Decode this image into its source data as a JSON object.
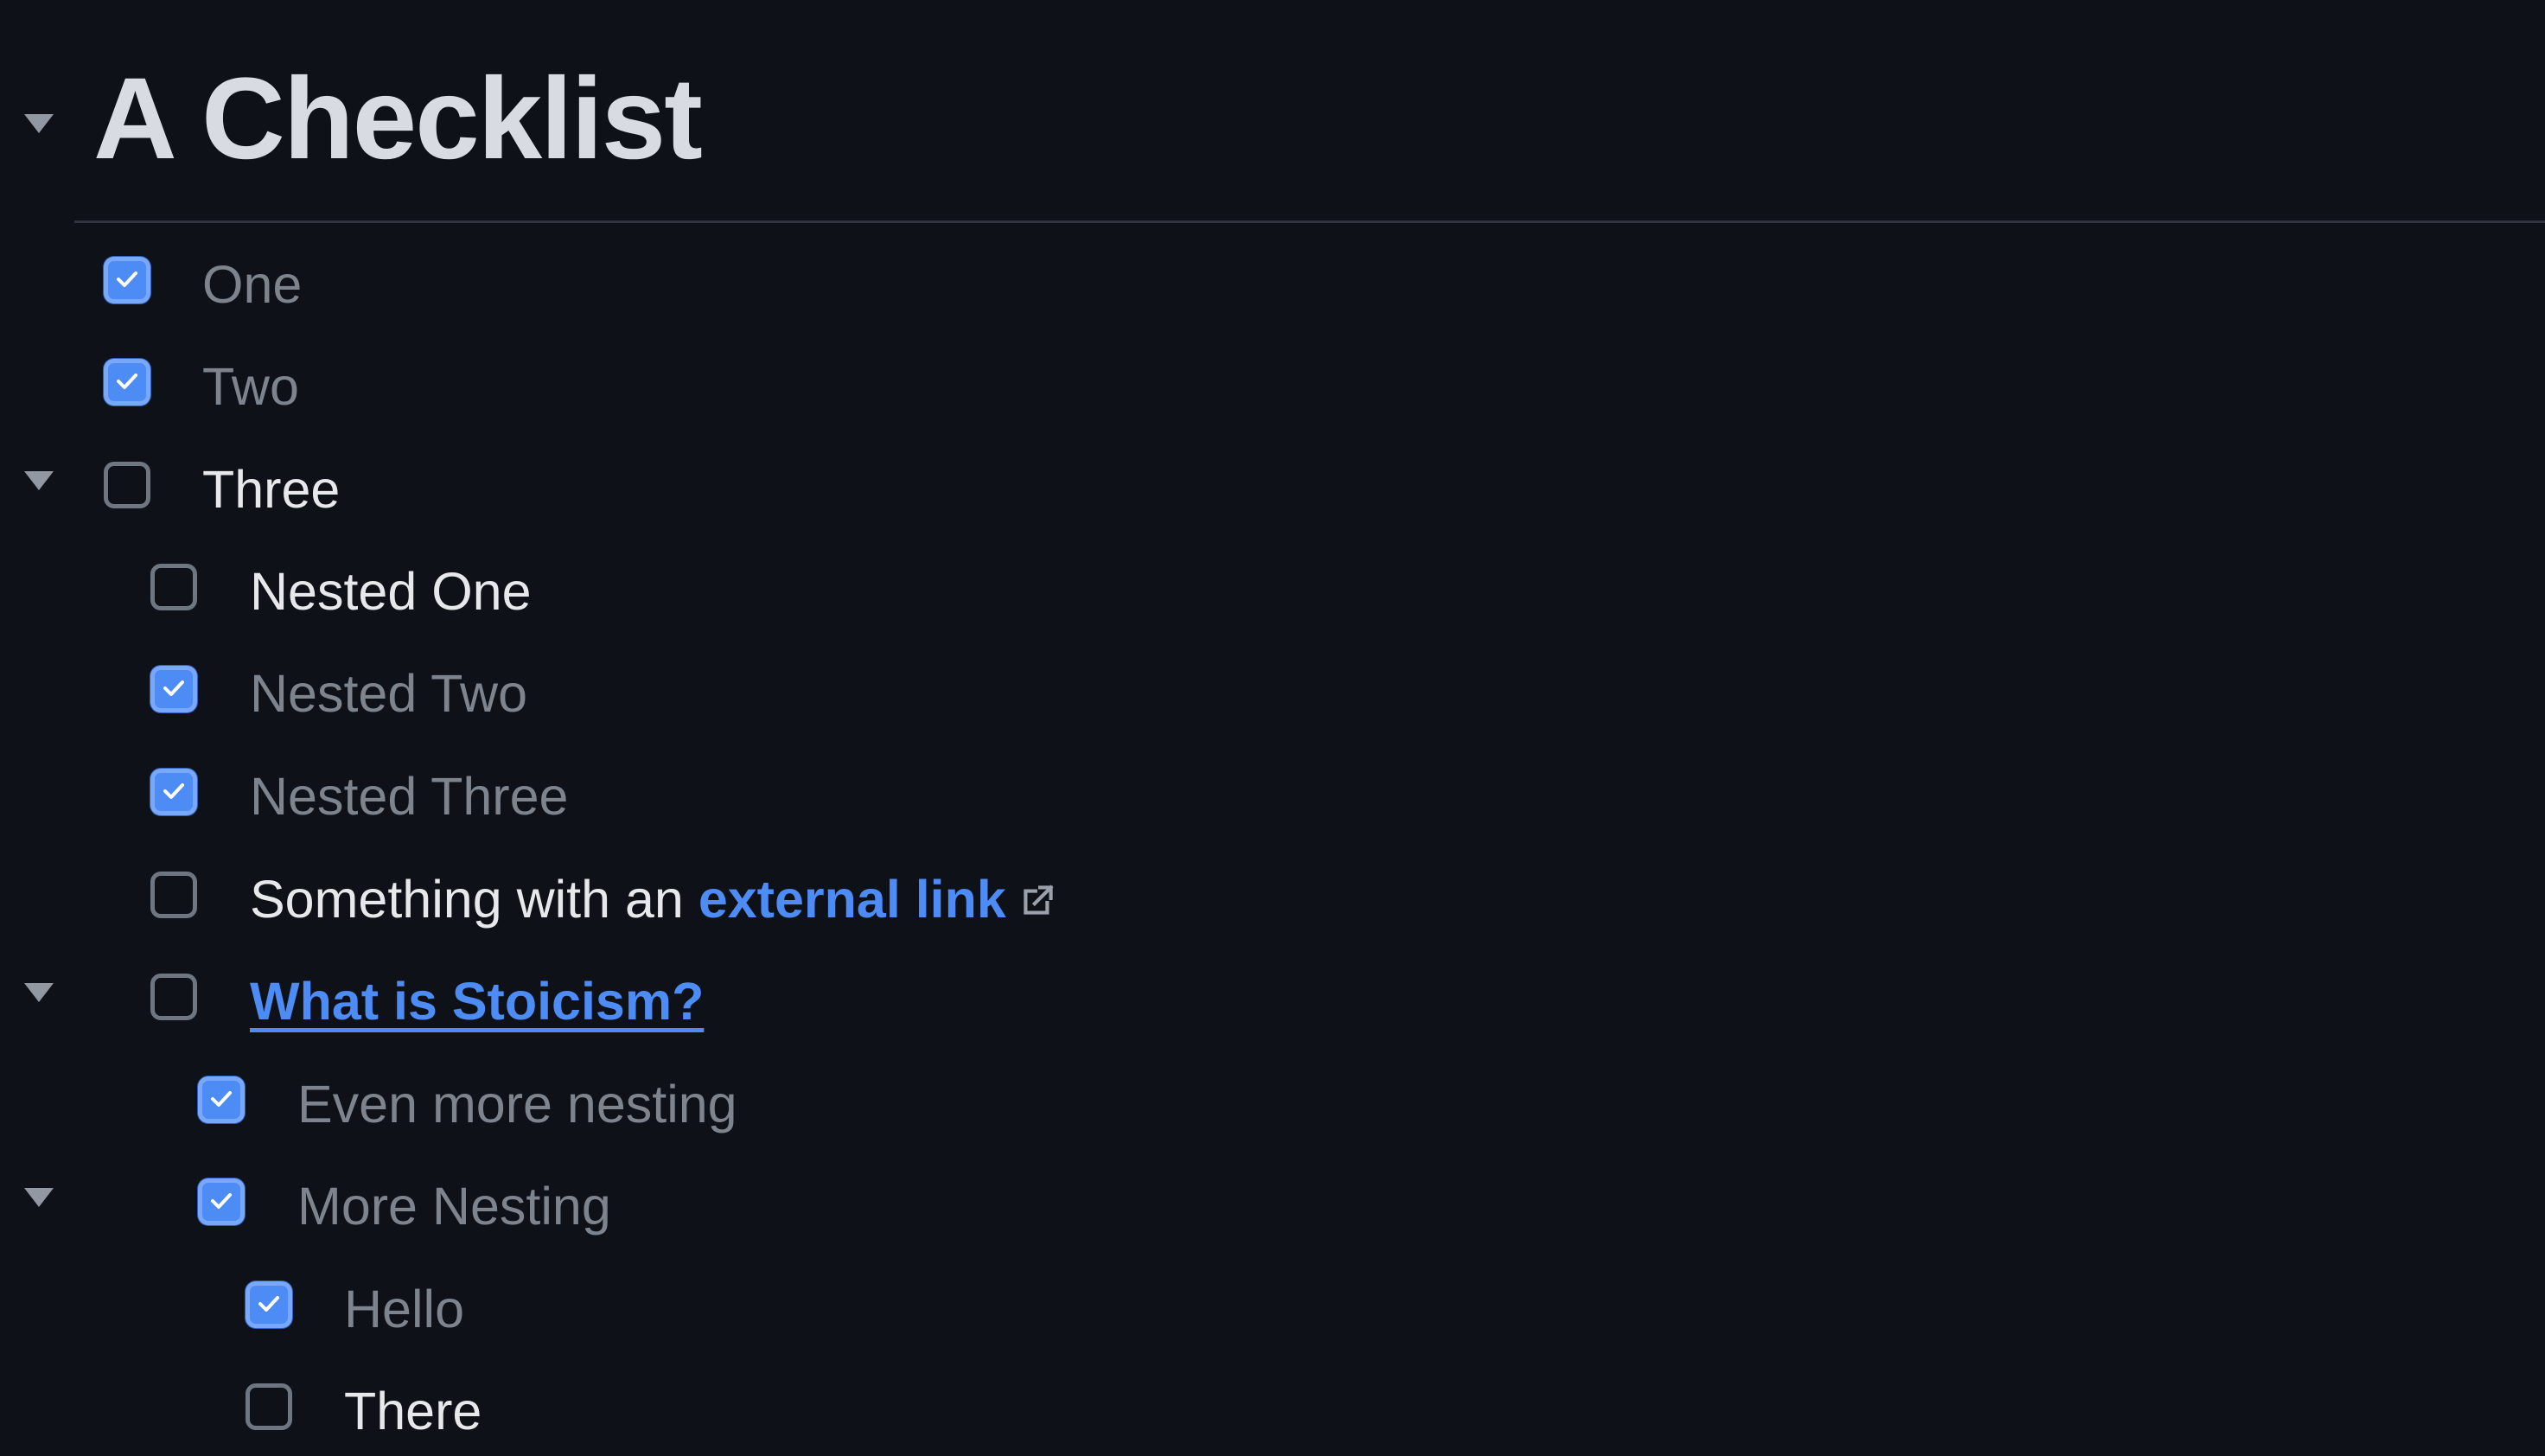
{
  "page": {
    "title": "A Checklist"
  },
  "items": [
    {
      "label": "One",
      "checked": true
    },
    {
      "label": "Two",
      "checked": true
    },
    {
      "label": "Three",
      "checked": false
    },
    {
      "label": "Nested One",
      "checked": false
    },
    {
      "label": "Nested Two",
      "checked": true
    },
    {
      "label": "Nested Three",
      "checked": true
    },
    {
      "label_prefix": "Something with an ",
      "link_text": "external link",
      "checked": false
    },
    {
      "link_text": "What is Stoicism?",
      "checked": false
    },
    {
      "label": "Even more nesting",
      "checked": true
    },
    {
      "label": "More Nesting",
      "checked": true
    },
    {
      "label": "Hello",
      "checked": true
    },
    {
      "label": "There",
      "checked": false
    }
  ],
  "icons": {
    "collapse_toggle": "triangle-down-icon",
    "checkmark": "check-icon",
    "external_link": "external-link-icon"
  },
  "colors": {
    "background": "#0e1117",
    "accent": "#4d8bf5",
    "text": "#e6e8eb",
    "text_done": "#7d848d"
  }
}
